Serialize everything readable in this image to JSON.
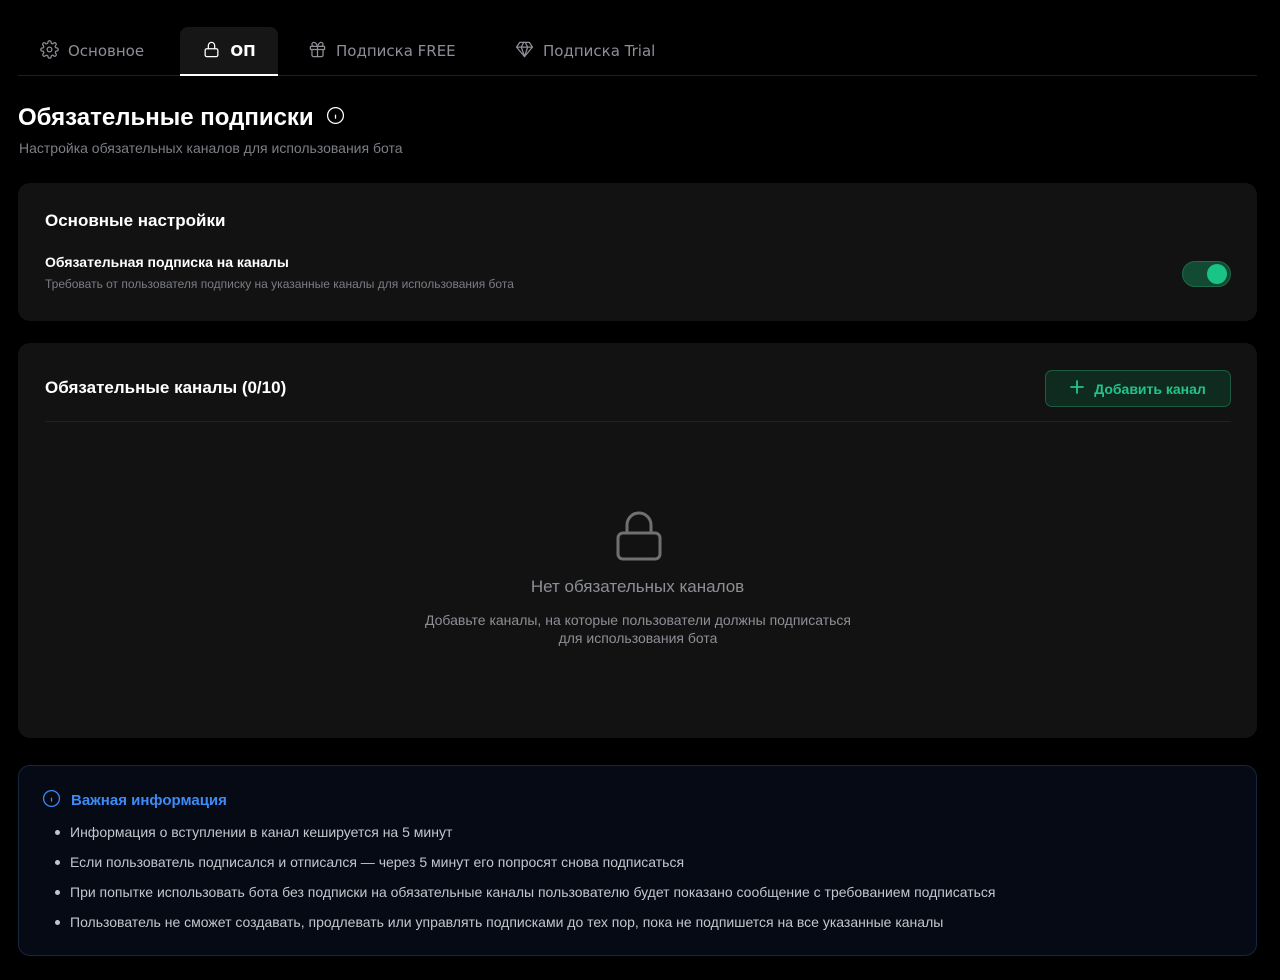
{
  "tabs": [
    {
      "label": "Основное",
      "icon": "gear-icon",
      "active": false
    },
    {
      "label": "ОП",
      "icon": "lock-icon",
      "active": true
    },
    {
      "label": "Подписка FREE",
      "icon": "gift-icon",
      "active": false
    },
    {
      "label": "Подписка Trial",
      "icon": "diamond-icon",
      "active": false
    }
  ],
  "header": {
    "title": "Обязательные подписки",
    "subtitle": "Настройка обязательных каналов для использования бота"
  },
  "settings": {
    "heading": "Основные настройки",
    "toggle_label": "Обязательная подписка на каналы",
    "toggle_description": "Требовать от пользователя подписку на указанные каналы для использования бота",
    "toggle_on": true
  },
  "channels": {
    "heading": "Обязательные каналы (0/10)",
    "add_button_label": "Добавить канал",
    "empty_title": "Нет обязательных каналов",
    "empty_description": "Добавьте каналы, на которые пользователи должны подписаться для использования бота"
  },
  "info": {
    "heading": "Важная информация",
    "items": [
      "Информация о вступлении в канал кешируется на 5 минут",
      "Если пользователь подписался и отписался — через 5 минут его попросят снова подписаться",
      "При попытке использовать бота без подписки на обязательные каналы пользователю будет показано сообщение с требованием подписаться",
      "Пользователь не сможет создавать, продлевать или управлять подписками до тех пор, пока не подпишется на все указанные каналы"
    ]
  },
  "colors": {
    "background": "#000000",
    "card": "#121212",
    "accent_green": "#22c489",
    "accent_blue": "#3d8bf7"
  }
}
